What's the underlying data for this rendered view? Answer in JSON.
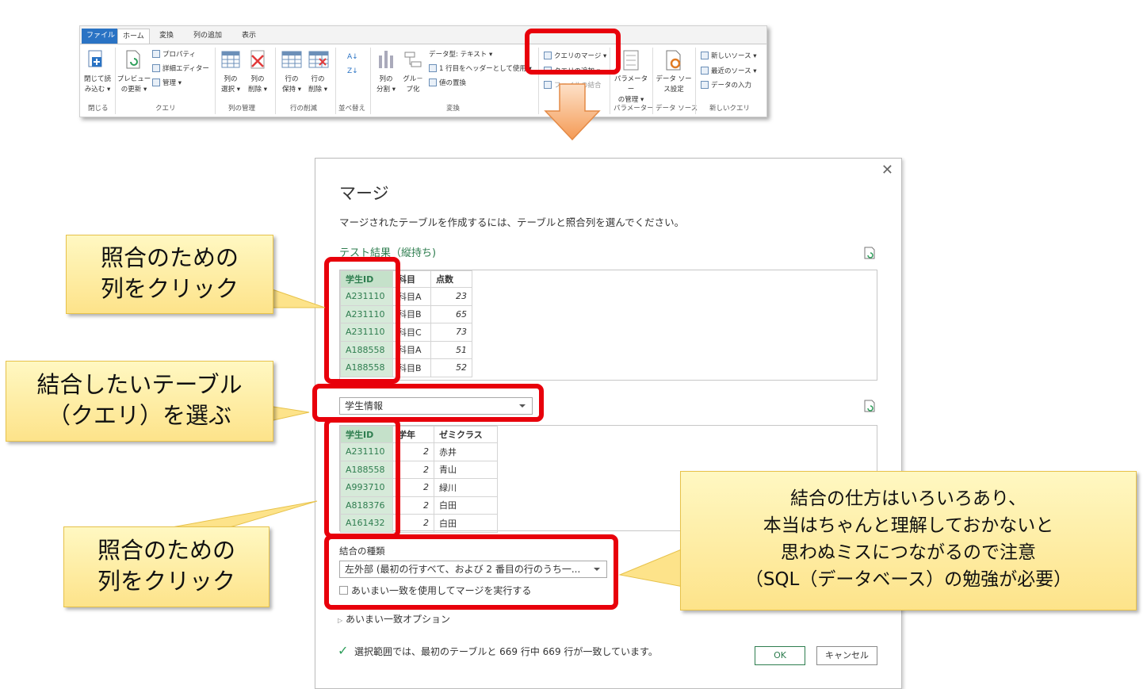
{
  "ribbon": {
    "tabs": [
      "ファイル",
      "ホーム",
      "変換",
      "列の追加",
      "表示"
    ],
    "groups": {
      "close": {
        "button": "閉じて読\nみ込む ▾",
        "label": "閉じる"
      },
      "query": {
        "preview": "プレビュー\nの更新 ▾",
        "items": [
          "プロパティ",
          "詳細エディター",
          "管理 ▾"
        ],
        "label": "クエリ"
      },
      "manage_columns": {
        "select": "列の\n選択 ▾",
        "remove": "列の\n削除 ▾",
        "label": "列の管理"
      },
      "reduce_rows": {
        "keep": "行の\n保持 ▾",
        "remove": "行の\n削除 ▾",
        "label": "行の削減"
      },
      "sort": {
        "label": "並べ替え"
      },
      "transform": {
        "split": "列の\n分割 ▾",
        "group": "グル－\nプ化",
        "items": [
          "データ型: テキスト ▾",
          "1 行目をヘッダーとして使用 ▾",
          "値の置換"
        ],
        "label": "変換"
      },
      "combine": {
        "items": [
          "クエリのマージ ▾",
          "クエリの追加 ▾",
          "ファイルの結合"
        ]
      },
      "parameters": {
        "button": "パラメーター\nの管理 ▾",
        "label": "パラメーター"
      },
      "data_source": {
        "button": "データ ソー\nス設定",
        "label": "データ ソース"
      },
      "new_query": {
        "items": [
          "新しいソース ▾",
          "最近のソース ▾",
          "データの入力"
        ],
        "label": "新しいクエリ"
      }
    }
  },
  "dialog": {
    "title": "マージ",
    "description": "マージされたテーブルを作成するには、テーブルと照合列を選んでください。",
    "table1_name": "テスト結果（縦持ち)",
    "table1": {
      "headers": [
        "学生ID",
        "科目",
        "点数"
      ],
      "rows": [
        [
          "A231110",
          "科目A",
          "23"
        ],
        [
          "A231110",
          "科目B",
          "65"
        ],
        [
          "A231110",
          "科目C",
          "73"
        ],
        [
          "A188558",
          "科目A",
          "51"
        ],
        [
          "A188558",
          "科目B",
          "52"
        ]
      ]
    },
    "table2_select": "学生情報",
    "table2": {
      "headers": [
        "学生ID",
        "学年",
        "ゼミクラス"
      ],
      "rows": [
        [
          "A231110",
          "2",
          "赤井"
        ],
        [
          "A188558",
          "2",
          "青山"
        ],
        [
          "A993710",
          "2",
          "緑川"
        ],
        [
          "A818376",
          "2",
          "白田"
        ],
        [
          "A161432",
          "2",
          "白田"
        ]
      ]
    },
    "join_kind_label": "結合の種類",
    "join_kind_value": "左外部 (最初の行すべて、および 2 番目の行のうち一...",
    "fuzzy_checkbox": "あいまい一致を使用してマージを実行する",
    "fuzzy_options": "あいまい一致オプション",
    "status": "選択範囲では、最初のテーブルと 669 行中 669 行が一致しています。",
    "ok": "OK",
    "cancel": "キャンセル"
  },
  "callouts": {
    "c1": "照合のための\n列をクリック",
    "c2": "結合したいテーブル\n（クエリ）を選ぶ",
    "c3": "照合のための\n列をクリック",
    "c4": "結合の仕方はいろいろあり、\n本当はちゃんと理解しておかないと\n思わぬミスにつながるので注意\n（SQL（データベース）の勉強が必要）"
  },
  "colors": {
    "highlight": "#e8000b",
    "accent_green": "#2e7d4f",
    "callout": "#fde38a",
    "arrow": "#f6a86a"
  }
}
